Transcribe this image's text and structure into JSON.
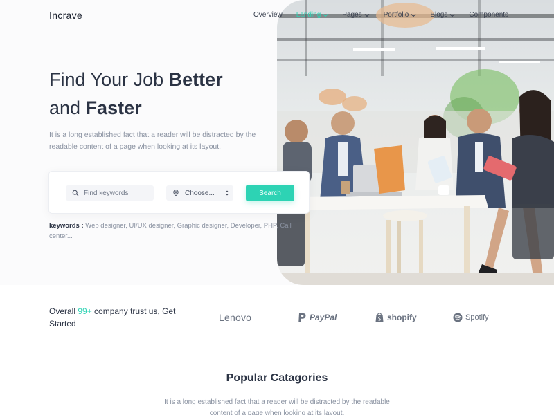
{
  "brand": {
    "name": "Incrave"
  },
  "nav": {
    "items": [
      {
        "label": "Overview",
        "has_dropdown": false,
        "active": false
      },
      {
        "label": "Landing",
        "has_dropdown": true,
        "active": true
      },
      {
        "label": "Pages",
        "has_dropdown": true,
        "active": false
      },
      {
        "label": "Portfolio",
        "has_dropdown": true,
        "active": false
      },
      {
        "label": "Blogs",
        "has_dropdown": true,
        "active": false
      },
      {
        "label": "Components",
        "has_dropdown": false,
        "active": false
      }
    ]
  },
  "hero": {
    "title_part1": "Find Your Job ",
    "title_bold1": "Better",
    "title_part2": "and ",
    "title_bold2": "Faster",
    "description": "It is a long established fact that a reader will be distracted by the readable content of a page when looking at its layout.",
    "image_icon": "office-team-photo"
  },
  "search": {
    "keyword_placeholder": "Find keywords",
    "keyword_value": "",
    "location_selected": "Choose...",
    "button_label": "Search"
  },
  "keywords": {
    "label": "keywords :",
    "list": "Web designer, UI/UX designer, Graphic designer, Developer, PHP, Call center..."
  },
  "trust": {
    "prefix": "Overall ",
    "count": "99+",
    "suffix": " company trust us, Get Started",
    "logos": [
      {
        "name": "Lenovo",
        "icon": "lenovo-logo"
      },
      {
        "name": "PayPal",
        "icon": "paypal-logo"
      },
      {
        "name": "shopify",
        "icon": "shopify-logo"
      },
      {
        "name": "Spotify",
        "icon": "spotify-logo"
      }
    ]
  },
  "categories": {
    "title": "Popular Catagories",
    "description": "It is a long established fact that a reader will be distracted by the readable content of a page when looking at its layout."
  },
  "colors": {
    "accent": "#2dd3b4",
    "heading": "#2b3344",
    "muted": "#8a92a1"
  }
}
